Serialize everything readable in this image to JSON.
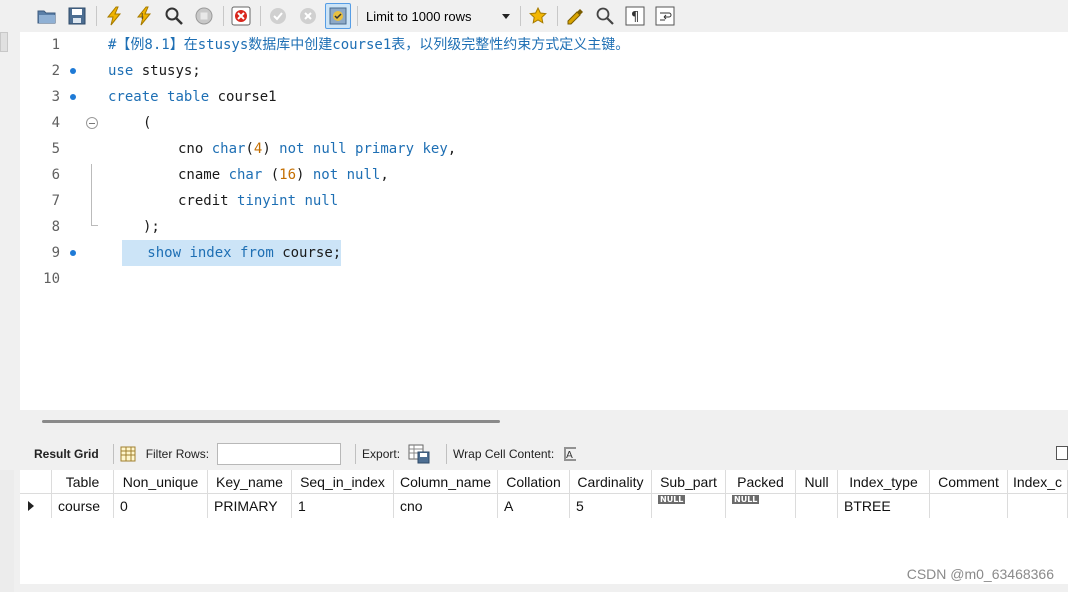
{
  "toolbar": {
    "limit_label": "Limit to 1000 rows",
    "buttons": [
      "open-folder-icon",
      "save-icon",
      "execute-icon",
      "execute-current-icon",
      "explain-icon",
      "stop-icon",
      "toggle-error-icon",
      "commit-icon",
      "rollback-icon",
      "autocommit-icon",
      "beautify-icon",
      "find-icon",
      "invisible-chars-icon",
      "wrap-icon",
      "favorites-icon"
    ]
  },
  "editor": {
    "lines": [
      {
        "n": "1",
        "dot": false,
        "fold": false,
        "indent": "",
        "tokens": [
          {
            "t": "#【例8.1】在stusys数据库中创建course1表，以列级完整性约束方式定义主键。",
            "c": "cmt"
          }
        ]
      },
      {
        "n": "2",
        "dot": true,
        "fold": false,
        "indent": "",
        "tokens": [
          {
            "t": "use",
            "c": "kw"
          },
          {
            "t": " stusys;",
            "c": "plain"
          }
        ]
      },
      {
        "n": "3",
        "dot": true,
        "fold": false,
        "indent": "",
        "tokens": [
          {
            "t": "create",
            "c": "kw"
          },
          {
            "t": " ",
            "c": "plain"
          },
          {
            "t": "table",
            "c": "kw"
          },
          {
            "t": " course1",
            "c": "plain"
          }
        ]
      },
      {
        "n": "4",
        "dot": false,
        "fold": true,
        "indent": "     ",
        "tokens": [
          {
            "t": "(",
            "c": "plain"
          }
        ]
      },
      {
        "n": "5",
        "dot": false,
        "fold": false,
        "indent": "          ",
        "tokens": [
          {
            "t": "cno ",
            "c": "plain"
          },
          {
            "t": "char",
            "c": "kw"
          },
          {
            "t": "(",
            "c": "plain"
          },
          {
            "t": "4",
            "c": "num"
          },
          {
            "t": ") ",
            "c": "plain"
          },
          {
            "t": "not null primary key",
            "c": "kw"
          },
          {
            "t": ",",
            "c": "plain"
          }
        ]
      },
      {
        "n": "6",
        "dot": false,
        "fold": false,
        "indent": "          ",
        "tokens": [
          {
            "t": "cname ",
            "c": "plain"
          },
          {
            "t": "char",
            "c": "kw"
          },
          {
            "t": " (",
            "c": "plain"
          },
          {
            "t": "16",
            "c": "num"
          },
          {
            "t": ") ",
            "c": "plain"
          },
          {
            "t": "not null",
            "c": "kw"
          },
          {
            "t": ",",
            "c": "plain"
          }
        ]
      },
      {
        "n": "7",
        "dot": false,
        "fold": false,
        "indent": "          ",
        "tokens": [
          {
            "t": "credit ",
            "c": "plain"
          },
          {
            "t": "tinyint null",
            "c": "kw"
          }
        ]
      },
      {
        "n": "8",
        "dot": false,
        "fold": false,
        "indent": "     ",
        "tokens": [
          {
            "t": ");",
            "c": "plain"
          }
        ]
      },
      {
        "n": "9",
        "dot": true,
        "fold": false,
        "indent": "  ",
        "highlight": true,
        "tokens": [
          {
            "t": "   ",
            "c": "plain"
          },
          {
            "t": "show",
            "c": "kw"
          },
          {
            "t": " ",
            "c": "plain"
          },
          {
            "t": "index",
            "c": "kw"
          },
          {
            "t": " ",
            "c": "plain"
          },
          {
            "t": "from",
            "c": "kw"
          },
          {
            "t": " course;",
            "c": "plain"
          }
        ]
      },
      {
        "n": "10",
        "dot": false,
        "fold": false,
        "indent": "",
        "tokens": []
      }
    ]
  },
  "result_bar": {
    "result_grid_label": "Result Grid",
    "filter_rows_label": "Filter Rows:",
    "filter_value": "",
    "export_label": "Export:",
    "wrap_label": "Wrap Cell Content:"
  },
  "grid": {
    "columns": [
      "Table",
      "Non_unique",
      "Key_name",
      "Seq_in_index",
      "Column_name",
      "Collation",
      "Cardinality",
      "Sub_part",
      "Packed",
      "Null",
      "Index_type",
      "Comment",
      "Index_c"
    ],
    "rows": [
      [
        "course",
        "0",
        "PRIMARY",
        "1",
        "cno",
        "A",
        "5",
        "NULL",
        "NULL",
        "",
        "BTREE",
        "",
        ""
      ]
    ]
  },
  "watermark": "CSDN @m0_63468366",
  "colors": {
    "keyword": "#1e6fb4",
    "number": "#c46e00",
    "selection": "#cce4f7",
    "bookmark_dot": "#1e7ad6"
  }
}
